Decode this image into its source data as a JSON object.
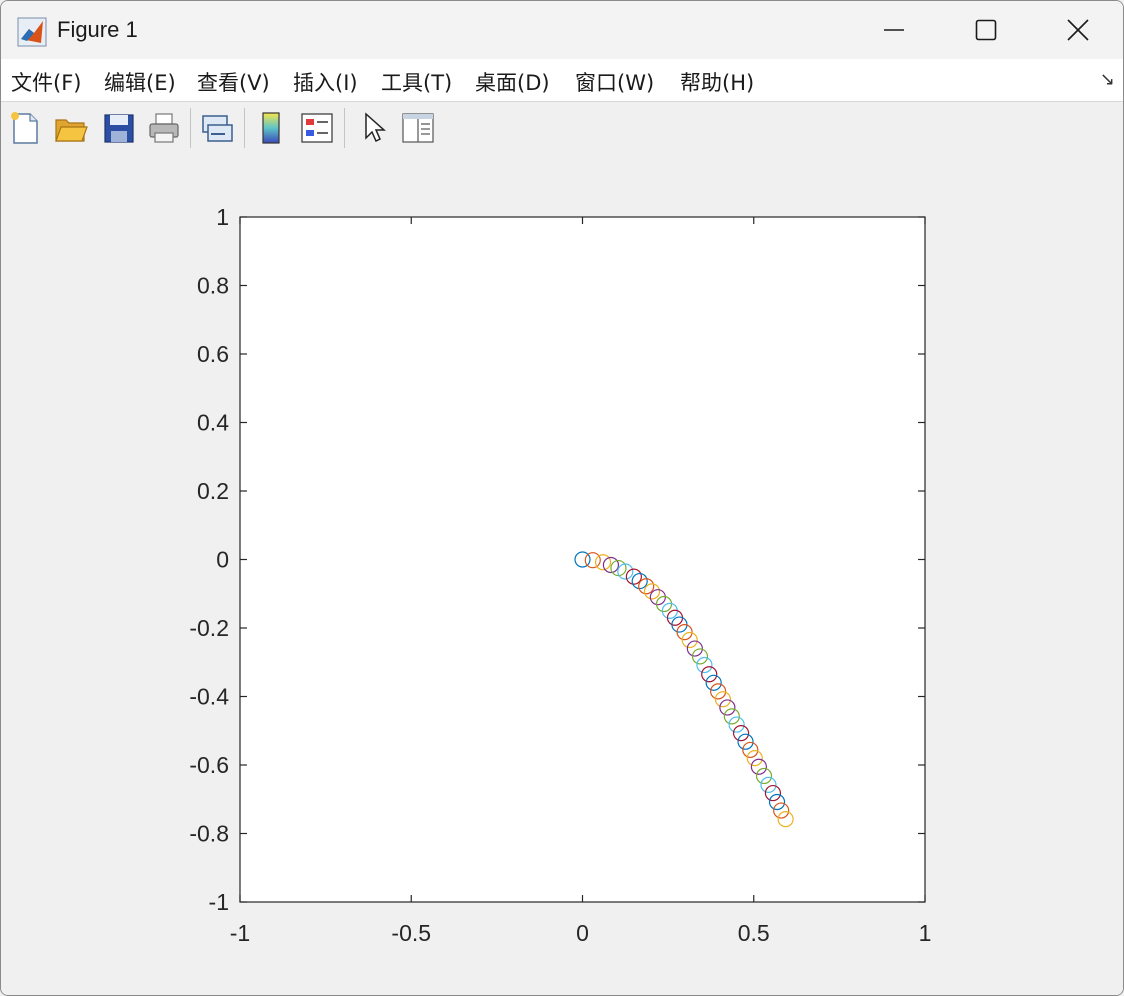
{
  "window": {
    "title": "Figure 1"
  },
  "menubar": {
    "items": [
      {
        "label": "文件(F)"
      },
      {
        "label": "编辑(E)"
      },
      {
        "label": "查看(V)"
      },
      {
        "label": "插入(I)"
      },
      {
        "label": "工具(T)"
      },
      {
        "label": "桌面(D)"
      },
      {
        "label": "窗口(W)"
      },
      {
        "label": "帮助(H)"
      }
    ]
  },
  "toolbar": {
    "buttons": [
      {
        "icon": "new-figure-icon"
      },
      {
        "icon": "open-file-icon"
      },
      {
        "icon": "save-icon"
      },
      {
        "icon": "print-icon"
      },
      {
        "icon": "link-plot-icon"
      },
      {
        "icon": "insert-colorbar-icon"
      },
      {
        "icon": "insert-legend-icon"
      },
      {
        "icon": "edit-plot-pointer-icon"
      },
      {
        "icon": "property-inspector-icon"
      }
    ]
  },
  "chart_data": {
    "type": "scatter",
    "marker": "circle",
    "xlim": [
      -1,
      1
    ],
    "ylim": [
      -1,
      1
    ],
    "xticks": [
      "-1",
      "-0.5",
      "0",
      "0.5",
      "1"
    ],
    "yticks": [
      "1",
      "0.8",
      "0.6",
      "0.4",
      "0.2",
      "0",
      "-0.2",
      "-0.4",
      "-0.6",
      "-0.8",
      "-1"
    ],
    "xtick_values": [
      -1,
      -0.5,
      0,
      0.5,
      1
    ],
    "ytick_values": [
      1,
      0.8,
      0.6,
      0.4,
      0.2,
      0,
      -0.2,
      -0.4,
      -0.6,
      -0.8,
      -1
    ],
    "grid": false,
    "color_order": [
      "#0072bd",
      "#d95319",
      "#edb120",
      "#7e2f8e",
      "#77ac30",
      "#4dbeee",
      "#a2142f"
    ],
    "points": [
      {
        "x": 0.0,
        "y": 0.0
      },
      {
        "x": 0.03,
        "y": -0.002
      },
      {
        "x": 0.06,
        "y": -0.008
      },
      {
        "x": 0.083,
        "y": -0.016
      },
      {
        "x": 0.105,
        "y": -0.025
      },
      {
        "x": 0.125,
        "y": -0.035
      },
      {
        "x": 0.15,
        "y": -0.05
      },
      {
        "x": 0.167,
        "y": -0.063
      },
      {
        "x": 0.186,
        "y": -0.078
      },
      {
        "x": 0.203,
        "y": -0.093
      },
      {
        "x": 0.22,
        "y": -0.11
      },
      {
        "x": 0.238,
        "y": -0.13
      },
      {
        "x": 0.255,
        "y": -0.15
      },
      {
        "x": 0.27,
        "y": -0.17
      },
      {
        "x": 0.283,
        "y": -0.19
      },
      {
        "x": 0.298,
        "y": -0.212
      },
      {
        "x": 0.313,
        "y": -0.235
      },
      {
        "x": 0.328,
        "y": -0.26
      },
      {
        "x": 0.343,
        "y": -0.283
      },
      {
        "x": 0.356,
        "y": -0.308
      },
      {
        "x": 0.37,
        "y": -0.335
      },
      {
        "x": 0.383,
        "y": -0.36
      },
      {
        "x": 0.396,
        "y": -0.385
      },
      {
        "x": 0.41,
        "y": -0.408
      },
      {
        "x": 0.423,
        "y": -0.432
      },
      {
        "x": 0.436,
        "y": -0.458
      },
      {
        "x": 0.45,
        "y": -0.482
      },
      {
        "x": 0.463,
        "y": -0.507
      },
      {
        "x": 0.476,
        "y": -0.532
      },
      {
        "x": 0.49,
        "y": -0.556
      },
      {
        "x": 0.503,
        "y": -0.58
      },
      {
        "x": 0.515,
        "y": -0.605
      },
      {
        "x": 0.53,
        "y": -0.632
      },
      {
        "x": 0.543,
        "y": -0.658
      },
      {
        "x": 0.556,
        "y": -0.682
      },
      {
        "x": 0.568,
        "y": -0.708
      },
      {
        "x": 0.58,
        "y": -0.733
      },
      {
        "x": 0.593,
        "y": -0.758
      }
    ]
  }
}
